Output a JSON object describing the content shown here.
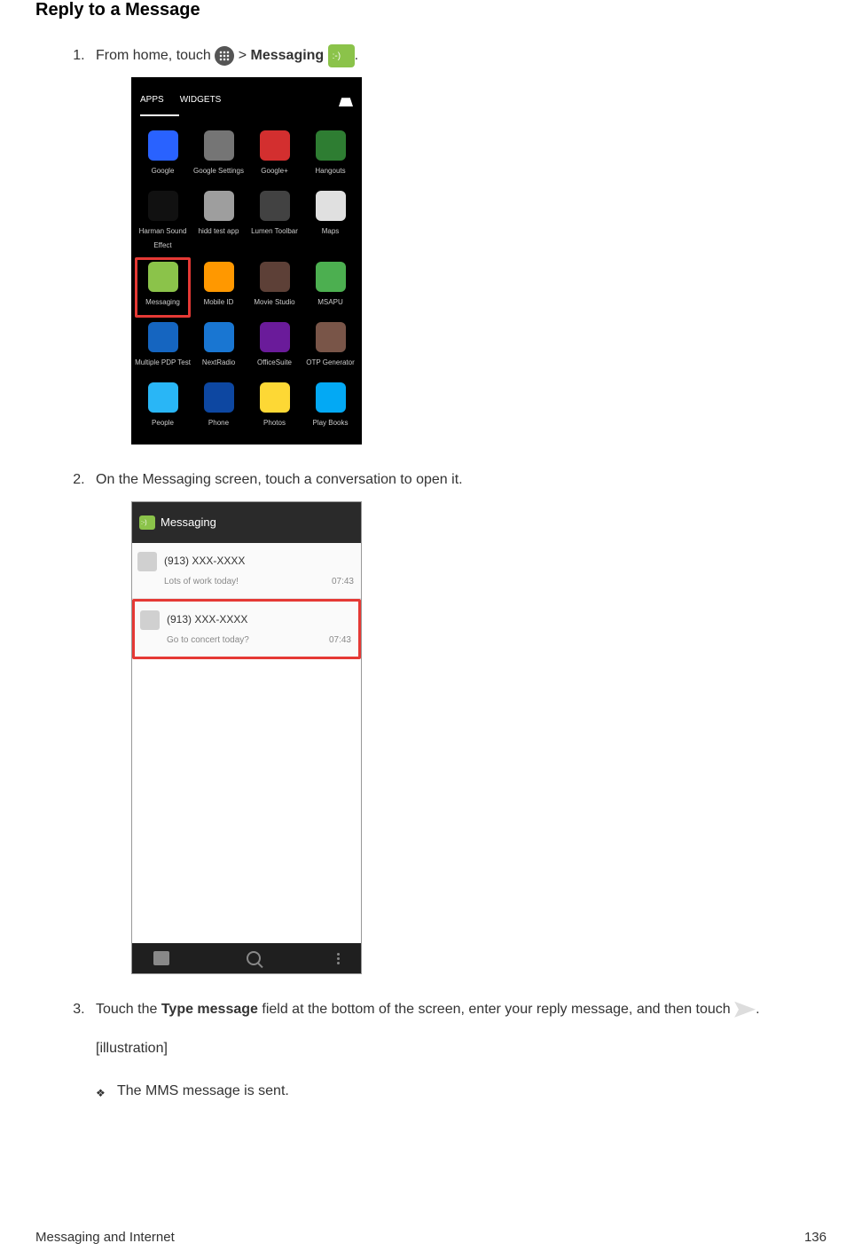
{
  "title": "Reply to a Message",
  "step1": {
    "pre": "From home, touch ",
    "mid": " > ",
    "bold": "Messaging ",
    "post": "."
  },
  "step2": "On the Messaging screen, touch a conversation to open it.",
  "step3": {
    "pre": "Touch the ",
    "bold": "Type message",
    "mid": " field at the bottom of the screen, enter your reply message, and then touch ",
    "post": "."
  },
  "illustration": "[illustration]",
  "bullet": "The MMS message is sent.",
  "footer_left": "Messaging and Internet",
  "footer_right": "136",
  "ss1": {
    "tab_apps": "APPS",
    "tab_widgets": "WIDGETS",
    "apps": [
      {
        "label": "Google",
        "color": "#2962ff"
      },
      {
        "label": "Google Settings",
        "color": "#757575"
      },
      {
        "label": "Google+",
        "color": "#d32f2f"
      },
      {
        "label": "Hangouts",
        "color": "#2e7d32"
      },
      {
        "label": "Harman Sound Effect",
        "color": "#111"
      },
      {
        "label": "hidd test app",
        "color": "#9e9e9e"
      },
      {
        "label": "Lumen Toolbar",
        "color": "#424242"
      },
      {
        "label": "Maps",
        "color": "#e0e0e0"
      },
      {
        "label": "Messaging",
        "color": "#8bc34a",
        "hl": true
      },
      {
        "label": "Mobile ID",
        "color": "#ff9800"
      },
      {
        "label": "Movie Studio",
        "color": "#5d4037"
      },
      {
        "label": "MSAPU",
        "color": "#4caf50"
      },
      {
        "label": "Multiple PDP Test",
        "color": "#1565c0"
      },
      {
        "label": "NextRadio",
        "color": "#1976d2"
      },
      {
        "label": "OfficeSuite",
        "color": "#6a1b9a"
      },
      {
        "label": "OTP Generator",
        "color": "#795548"
      },
      {
        "label": "People",
        "color": "#29b6f6"
      },
      {
        "label": "Phone",
        "color": "#0d47a1"
      },
      {
        "label": "Photos",
        "color": "#fdd835"
      },
      {
        "label": "Play Books",
        "color": "#03a9f4"
      }
    ]
  },
  "ss2": {
    "header": "Messaging",
    "rows": [
      {
        "num": "(913) XXX-XXXX",
        "text": "Lots of work today!",
        "time": "07:43",
        "hl": false
      },
      {
        "num": "(913) XXX-XXXX",
        "text": "Go to concert today?",
        "time": "07:43",
        "hl": true
      }
    ]
  }
}
